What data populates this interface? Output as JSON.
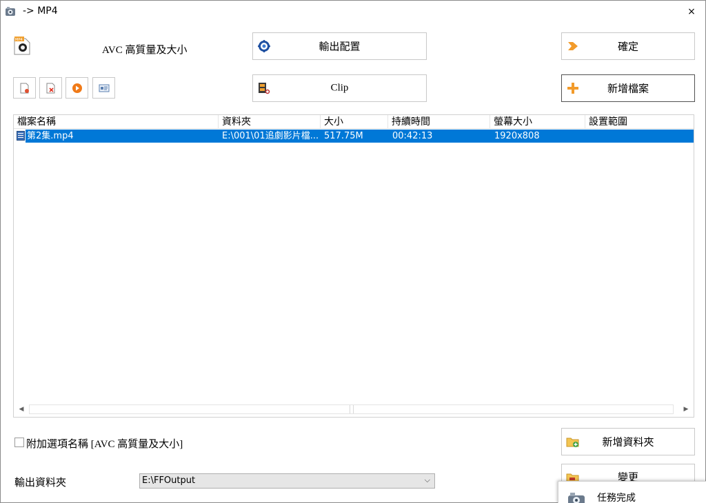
{
  "window": {
    "title": "-> MP4",
    "close_glyph": "×"
  },
  "profile": {
    "name": "AVC 高質量及大小",
    "icon": "mp4-file-icon"
  },
  "buttons": {
    "output_config": "輸出配置",
    "clip": "Clip",
    "ok": "確定",
    "add_file": "新增檔案",
    "add_folder": "新增資料夾",
    "change": "變更"
  },
  "toolbar_icons": [
    "add-item-icon",
    "remove-item-icon",
    "play-icon",
    "info-icon"
  ],
  "list": {
    "columns": [
      "檔案名稱",
      "資料夾",
      "大小",
      "持續時間",
      "螢幕大小",
      "設置範圍"
    ],
    "rows": [
      {
        "name": "第2集.mp4",
        "folder": "E:\\001\\01追劇影片檔...",
        "size": "517.75M",
        "duration": "00:42:13",
        "resolution": "1920x808",
        "range": ""
      }
    ]
  },
  "options": {
    "append_label": "附加選項名稱 [AVC 高質量及大小]",
    "append_checked": false
  },
  "output": {
    "label": "輸出資料夾",
    "folder": "E:\\FFOutput"
  },
  "toast": {
    "text": "任務完成"
  },
  "colors": {
    "selection": "#0078d7",
    "accent_orange": "#f29b2b",
    "border": "#c8c8c8"
  }
}
